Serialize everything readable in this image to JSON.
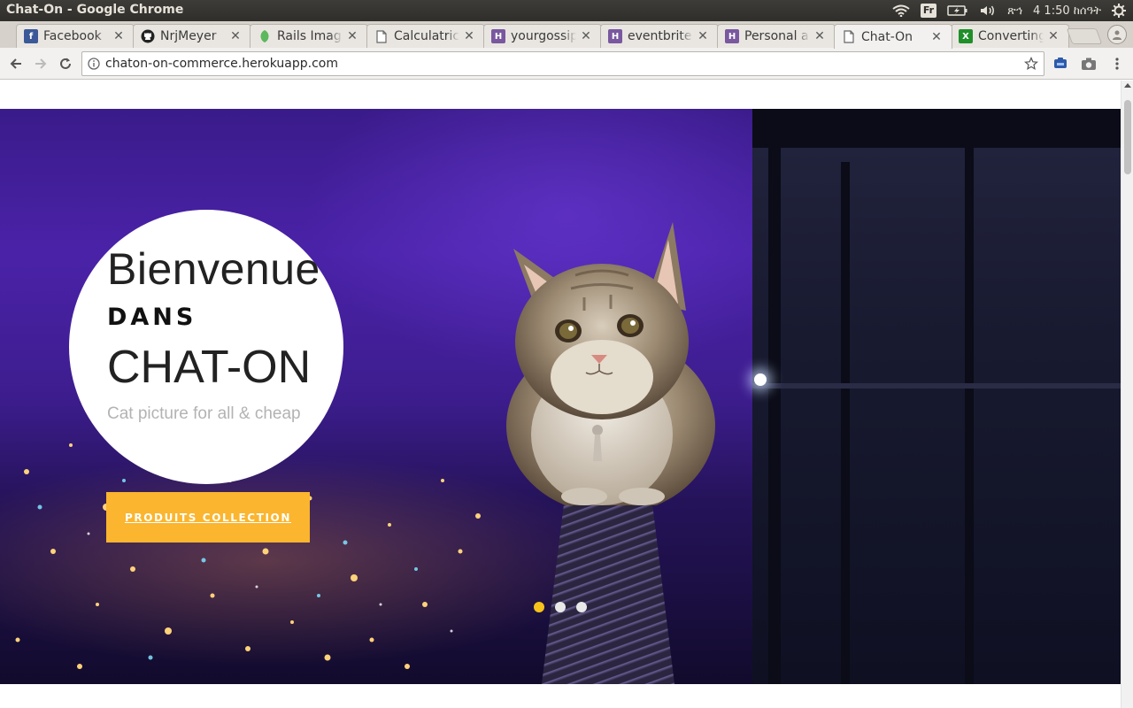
{
  "os": {
    "window_title": "Chat-On - Google Chrome",
    "keyboard_layout": "Fr",
    "clock": "4 1:50 ከሰዓት",
    "tray_glyph": "ጽኅ",
    "icons": [
      "wifi-icon",
      "keyboard-layout-icon",
      "battery-icon",
      "volume-icon",
      "settings-gear-icon"
    ]
  },
  "tabs": [
    {
      "label": "Facebook",
      "favicon": "facebook-icon",
      "color": "#3b5998"
    },
    {
      "label": "NrjMeyer",
      "favicon": "github-icon",
      "color": "#222222"
    },
    {
      "label": "Rails Image",
      "favicon": "leaf-icon",
      "color": "#5cb85c"
    },
    {
      "label": "Calculatrice",
      "favicon": "page-icon",
      "color": "#888888"
    },
    {
      "label": "yourgossip",
      "favicon": "heroku-icon",
      "color": "#79589f"
    },
    {
      "label": "eventbrite",
      "favicon": "heroku-icon",
      "color": "#79589f"
    },
    {
      "label": "Personal a",
      "favicon": "heroku-icon",
      "color": "#79589f"
    },
    {
      "label": "Chat-On",
      "favicon": "page-icon",
      "color": "#888888",
      "active": true
    },
    {
      "label": "Converting",
      "favicon": "excel-icon",
      "color": "#1f8f2a"
    }
  ],
  "toolbar": {
    "url": "chaton-on-commerce.herokuapp.com"
  },
  "hero": {
    "welcome": "Bienvenue",
    "dans": "DANS",
    "brand": "CHAT-ON",
    "tagline": "Cat picture for all & cheap",
    "cta_label": "PRODUITS COLLECTION",
    "slide_count": 3,
    "active_slide": 1
  },
  "colors": {
    "cta": "#fbb52e",
    "active_dot": "#f6c21c",
    "hero_sky": "#4a22a8"
  }
}
